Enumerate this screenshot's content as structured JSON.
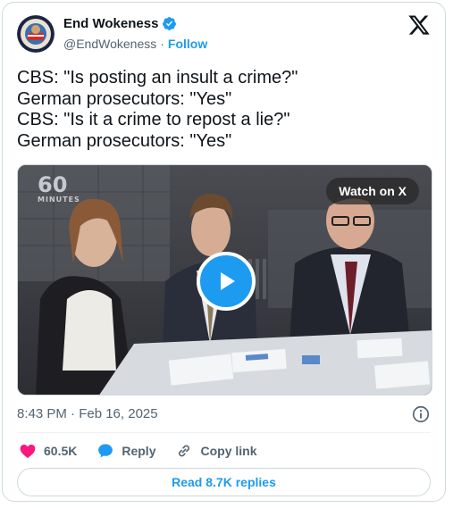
{
  "author": {
    "display_name": "End Wokeness",
    "handle": "@EndWokeness",
    "separator": "·",
    "follow_label": "Follow",
    "verified_color": "#1d9bf0"
  },
  "tweet": {
    "lines": [
      "CBS: \"Is posting an insult a crime?\"",
      "German prosecutors: \"Yes\"",
      "CBS: \"Is it a crime to repost a lie?\"",
      "German prosecutors: \"Yes\""
    ]
  },
  "media": {
    "watch_label": "Watch on X",
    "logo_number": "60",
    "logo_word": "MINUTES",
    "play_color": "#1d9bf0"
  },
  "meta": {
    "timestamp": "8:43 PM · Feb 16, 2025"
  },
  "actions": {
    "likes": "60.5K",
    "reply_label": "Reply",
    "copy_label": "Copy link",
    "like_color": "#f91880",
    "reply_color": "#1d9bf0"
  },
  "read_replies_label": "Read 8.7K replies",
  "icons": [
    "avatar-seal",
    "verified-badge-icon",
    "x-logo-icon",
    "play-icon",
    "info-icon",
    "heart-icon",
    "reply-bubble-icon",
    "link-icon"
  ]
}
